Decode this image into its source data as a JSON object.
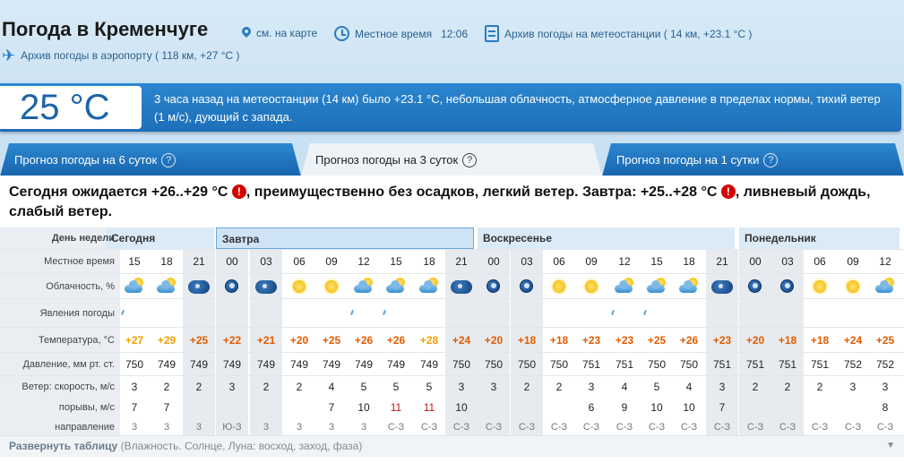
{
  "header": {
    "title": "Погода в Кременчуге",
    "map_link": "см. на карте",
    "local_time_label": "Местное время",
    "local_time": "12:06",
    "station_archive": "Архив погоды на метеостанции ( 14 км, +23.1 °C )",
    "airport_archive": "Архив погоды в аэропорту ( 118 км, +27 °C )"
  },
  "current": {
    "temp": "25 °C",
    "text": "3 часа назад на метеостанции (14 км) было +23.1 °C, небольшая облачность, атмосферное давление в пределах нормы, тихий ветер (1 м/с), дующий с запада."
  },
  "tabs": [
    "Прогноз погоды на 6 суток",
    "Прогноз погоды на 3 суток",
    "Прогноз погоды на 1 сутки"
  ],
  "tab_help": "?",
  "summary": {
    "part1": "Сегодня ожидается +26..+29 °C",
    "part2": ", преимущественно без осадков, легкий ветер. Завтра: +25..+28 °C",
    "part3": ", ливневый дождь, слабый ветер.",
    "alert": "!"
  },
  "labels": {
    "day": "День недели",
    "time": "Местное время",
    "cloud": "Облачность, %",
    "phen": "Явления погоды",
    "temp": "Температура, °C",
    "pressure": "Давление, мм рт. ст.",
    "wind_speed": "Ветер: скорость, м/с",
    "gusts": "порывы, м/с",
    "direction": "направление"
  },
  "days": [
    "Сегодня",
    "Завтра",
    "Воскресенье",
    "Понедельник"
  ],
  "times": [
    "15",
    "18",
    "21",
    "00",
    "03",
    "06",
    "09",
    "12",
    "15",
    "18",
    "21",
    "00",
    "03",
    "06",
    "09",
    "12",
    "15",
    "18",
    "21",
    "00",
    "03",
    "06",
    "09",
    "12"
  ],
  "temps": [
    "+27",
    "+29",
    "+25",
    "+22",
    "+21",
    "+20",
    "+25",
    "+26",
    "+26",
    "+28",
    "+24",
    "+20",
    "+18",
    "+18",
    "+23",
    "+23",
    "+25",
    "+26",
    "+23",
    "+20",
    "+18",
    "+18",
    "+24",
    "+25"
  ],
  "pressure": [
    "750",
    "749",
    "749",
    "749",
    "749",
    "749",
    "749",
    "749",
    "749",
    "749",
    "750",
    "750",
    "750",
    "750",
    "751",
    "751",
    "750",
    "750",
    "751",
    "751",
    "751",
    "751",
    "752",
    "752"
  ],
  "wind": [
    "3",
    "2",
    "2",
    "3",
    "2",
    "2",
    "4",
    "5",
    "5",
    "5",
    "3",
    "3",
    "2",
    "2",
    "3",
    "4",
    "5",
    "4",
    "3",
    "2",
    "2",
    "2",
    "3",
    "3"
  ],
  "gusts": [
    "7",
    "7",
    "",
    "",
    "",
    "",
    "7",
    "10",
    "11",
    "11",
    "10",
    "",
    "",
    "",
    "6",
    "9",
    "10",
    "10",
    "7",
    "",
    "",
    "",
    "",
    "8"
  ],
  "direction": [
    "3",
    "3",
    "3",
    "Ю-З",
    "3",
    "3",
    "3",
    "3",
    "С-З",
    "С-З",
    "С-З",
    "С-З",
    "С-З",
    "С-З",
    "С-З",
    "С-З",
    "С-З",
    "С-З",
    "С-З",
    "С-З",
    "С-З",
    "С-З",
    "С-З",
    "С-З"
  ],
  "icons": [
    "sun-cloud",
    "sun-cloud",
    "night-cloud",
    "night-clear",
    "night-cloud",
    "sun",
    "sun",
    "sun-cloud",
    "sun-cloud",
    "sun-cloud",
    "night-cloud",
    "night-clear",
    "night-clear",
    "sun",
    "sun",
    "sun-cloud",
    "sun-cloud",
    "sun-cloud",
    "night-cloud",
    "night-clear",
    "night-clear",
    "sun",
    "sun",
    "sun-cloud"
  ],
  "rain": [
    true,
    false,
    false,
    false,
    false,
    false,
    false,
    true,
    true,
    false,
    false,
    false,
    false,
    false,
    false,
    true,
    true,
    false,
    false,
    false,
    false,
    false,
    false,
    false
  ],
  "expand": {
    "label": "Развернуть таблицу",
    "sub": "(Влажность. Солнце, Луна: восход, заход, фаза)"
  }
}
